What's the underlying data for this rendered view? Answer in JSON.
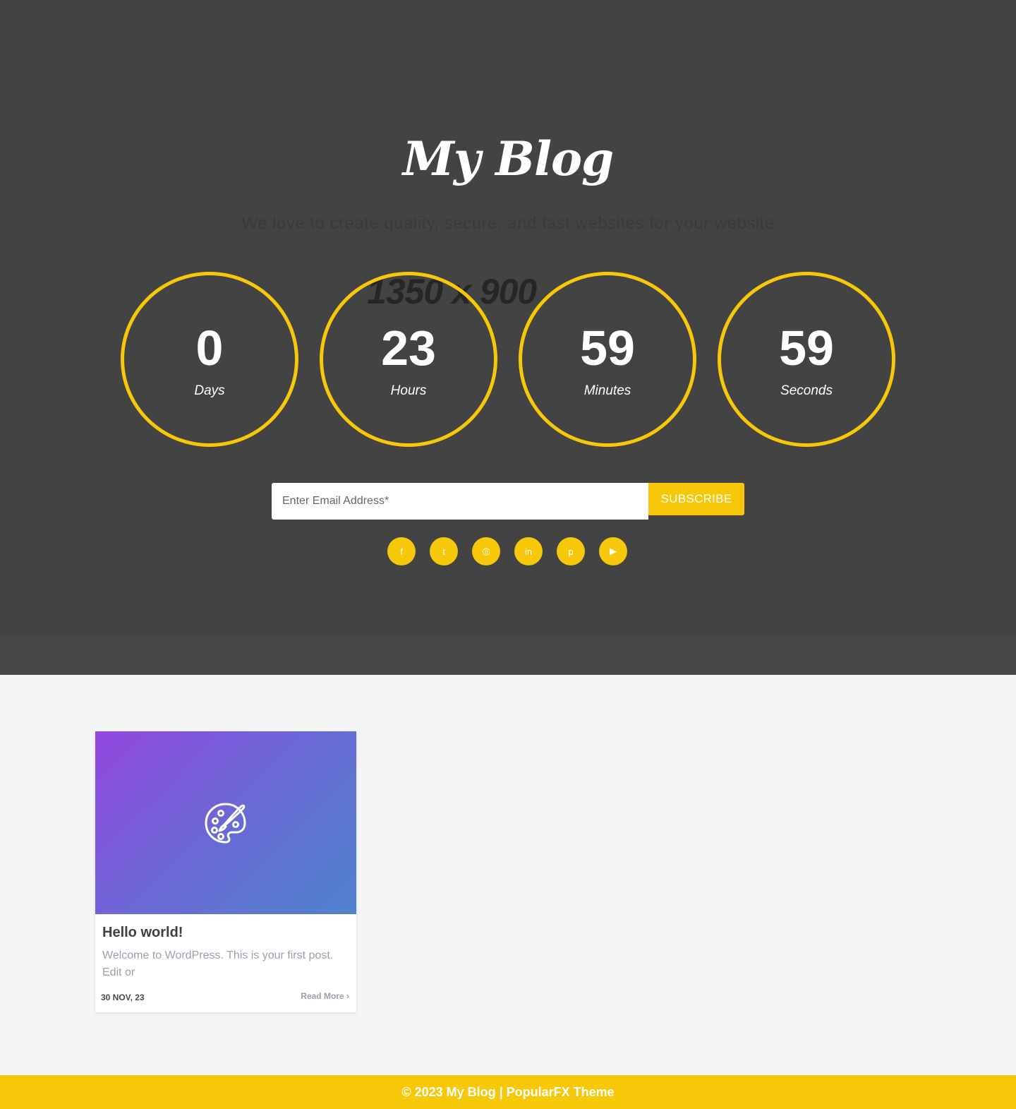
{
  "hero": {
    "site_title": "My Blog",
    "tagline": "We love to create quality, secure, and fast websites for your website",
    "placeholder_text": "1350 x 900",
    "background_color": "#434343",
    "accent_color": "#f7c80a"
  },
  "countdown": [
    {
      "value": "0",
      "label": "Days"
    },
    {
      "value": "23",
      "label": "Hours"
    },
    {
      "value": "59",
      "label": "Minutes"
    },
    {
      "value": "59",
      "label": "Seconds"
    }
  ],
  "subscribe": {
    "email_placeholder": "Enter Email Address*",
    "email_value": "",
    "button_label": "SUBSCRIBE"
  },
  "social_icons": [
    {
      "name": "facebook-icon",
      "glyph": "f"
    },
    {
      "name": "twitter-icon",
      "glyph": "t"
    },
    {
      "name": "instagram-icon",
      "glyph": "◎"
    },
    {
      "name": "linkedin-icon",
      "glyph": "in"
    },
    {
      "name": "pinterest-icon",
      "glyph": "p"
    },
    {
      "name": "youtube-icon",
      "glyph": "▶"
    }
  ],
  "post": {
    "title": "Hello world!",
    "excerpt": "Welcome to WordPress. This is your first post. Edit or",
    "date": "30 NOV, 23",
    "read_more": "Read More",
    "thumbnail_icon": "palette-icon"
  },
  "footer": {
    "text": "© 2023 My Blog | PopularFX Theme"
  }
}
